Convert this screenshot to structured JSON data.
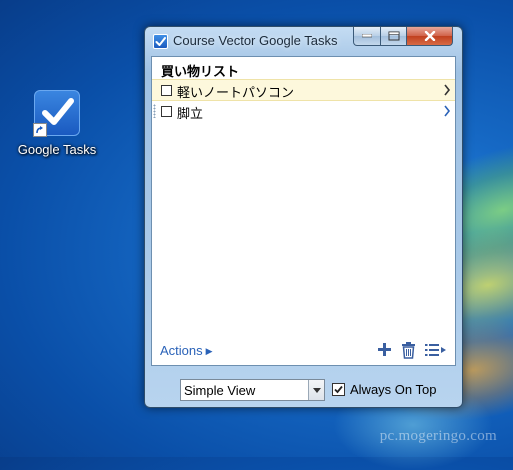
{
  "desktop": {
    "icon": {
      "label": "Google Tasks",
      "icon_name": "google-tasks-check-icon"
    },
    "watermark": "pc.mogeringo.com"
  },
  "window": {
    "title": "Course Vector Google Tasks",
    "app_icon": "checkbox-check-icon",
    "controls": [
      "minimize",
      "maximize",
      "close"
    ]
  },
  "task_list": {
    "title": "買い物リスト",
    "tasks": [
      {
        "text": "軽いノートパソコン",
        "checked": false,
        "selected": true
      },
      {
        "text": "脚立",
        "checked": false,
        "selected": false
      }
    ]
  },
  "toolbar": {
    "actions_label": "Actions",
    "add_icon": "plus-icon",
    "delete_icon": "trash-icon",
    "list_menu_icon": "list-menu-icon"
  },
  "footer": {
    "view_select": {
      "value": "Simple View"
    },
    "always_on_top": {
      "label": "Always On Top",
      "checked": true
    }
  },
  "colors": {
    "selected_row": "#fdf8dc",
    "link": "#2a62b8",
    "close_button": "#c0401f",
    "desktop_blue": "#1669c5"
  }
}
